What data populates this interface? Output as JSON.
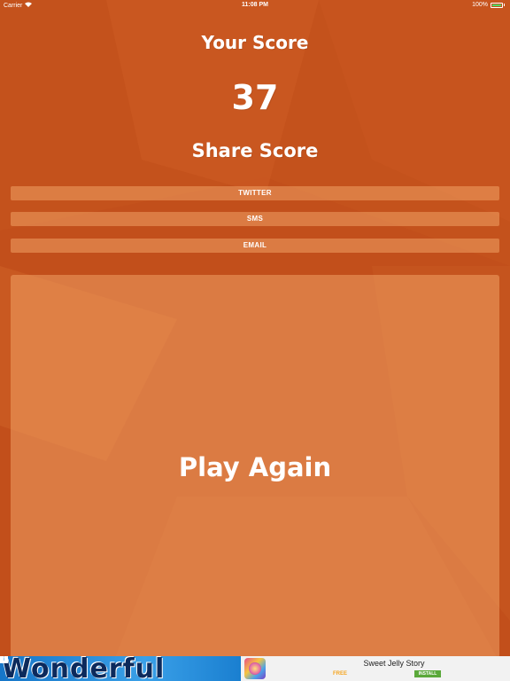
{
  "status_bar": {
    "carrier": "Carrier",
    "time": "11:08 PM",
    "battery": "100%"
  },
  "score": {
    "title": "Your Score",
    "value": "37"
  },
  "share": {
    "title": "Share Score",
    "buttons": [
      "TWITTER",
      "SMS",
      "EMAIL"
    ]
  },
  "play": {
    "label": "Play Again"
  },
  "ad": {
    "graphic_text": "Wonderful",
    "app_title": "Sweet Jelly Story",
    "price": "FREE",
    "install": "INSTALL",
    "info_icon": "i-x"
  },
  "colors": {
    "background": "#c4511c",
    "panel": "#e3884a",
    "text": "#ffffff"
  }
}
